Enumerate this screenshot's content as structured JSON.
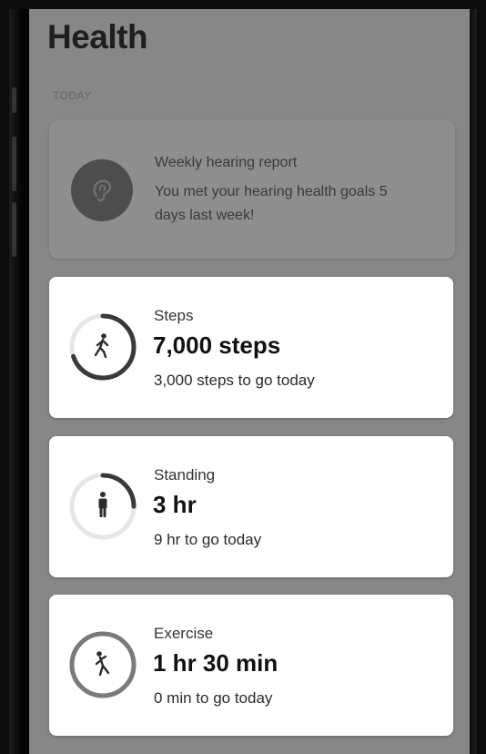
{
  "header": {
    "title": "Health",
    "section_label": "TODAY"
  },
  "hearing_card": {
    "title": "Weekly hearing report",
    "body": "You met your hearing health goals 5 days last week!",
    "icon": "ear-icon"
  },
  "metrics": [
    {
      "label": "Steps",
      "value": "7,000 steps",
      "sub": "3,000 steps to go today",
      "icon": "walking-icon",
      "progress": 0.7
    },
    {
      "label": "Standing",
      "value": "3 hr",
      "sub": "9 hr to go today",
      "icon": "standing-person-icon",
      "progress": 0.25
    },
    {
      "label": "Exercise",
      "value": "1 hr 30 min",
      "sub": "0 min to go today",
      "icon": "exercise-icon",
      "progress": 1.0
    }
  ],
  "colors": {
    "ring_progress": "#3a3a3a",
    "ring_track": "#e6e6e6",
    "ring_complete": "#7a7a7a",
    "overlay": "#878787"
  }
}
